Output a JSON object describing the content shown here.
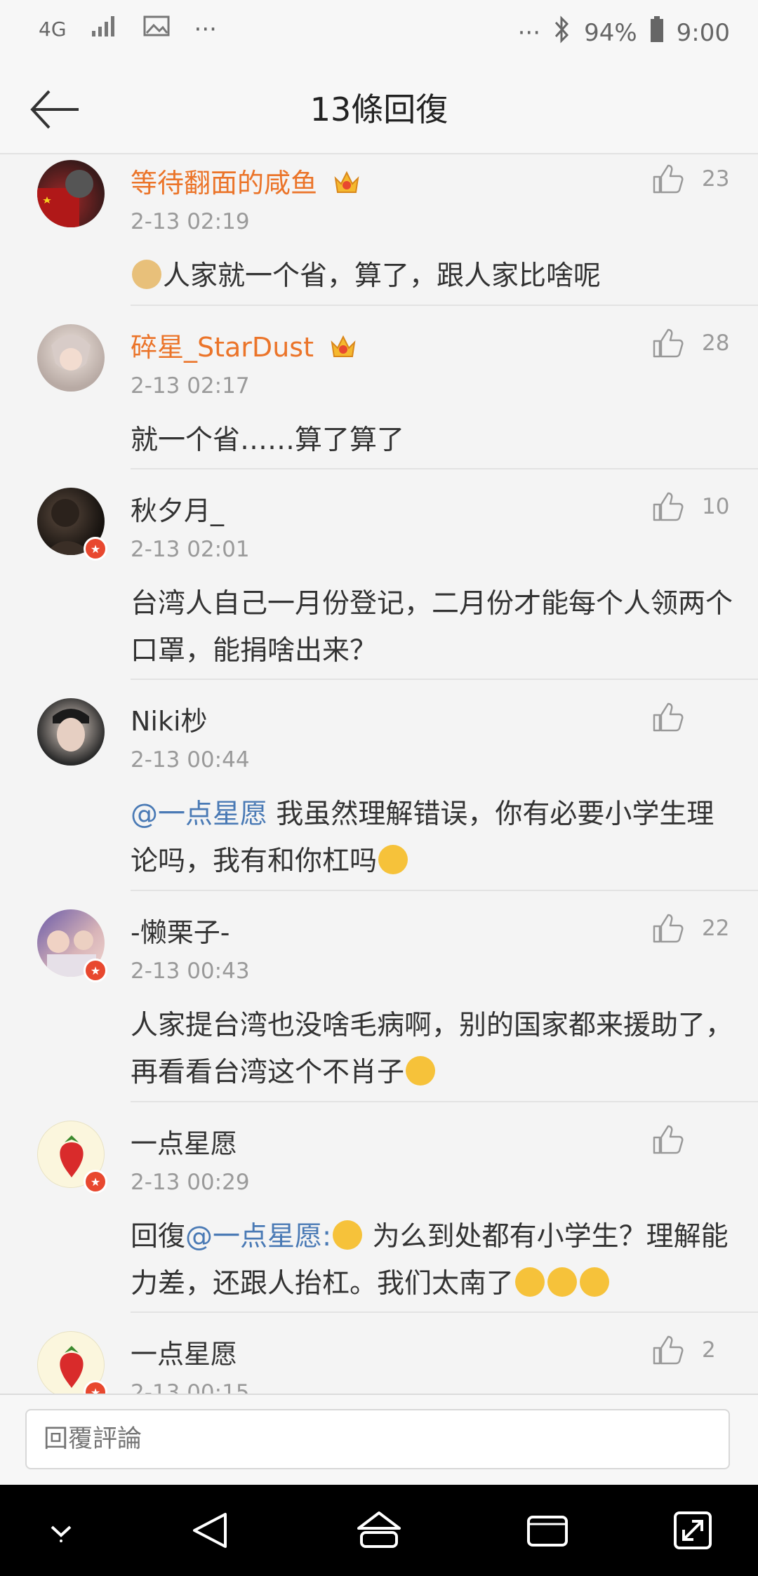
{
  "status_bar": {
    "network": "4G",
    "more_left": "···",
    "more_right": "···",
    "battery": "94%",
    "time": "9:00"
  },
  "header": {
    "title": "13條回復"
  },
  "comments": [
    {
      "name": "等待翻面的咸鱼",
      "time": "2-13 02:19",
      "text": "人家就一个省，算了，跟人家比啥呢",
      "likes": "23"
    },
    {
      "name": "碎星_StarDust",
      "time": "2-13 02:17",
      "text": "就一个省……算了算了",
      "likes": "28"
    },
    {
      "name": "秋夕月_",
      "time": "2-13 02:01",
      "text": "台湾人自己一月份登记，二月份才能每个人领两个口罩，能捐啥出来？",
      "likes": "10"
    },
    {
      "name": "Niki杪",
      "time": "2-13 00:44",
      "mention": "@一点星愿",
      "text": " 我虽然理解错误，你有必要小学生理论吗，我有和你杠吗",
      "likes": ""
    },
    {
      "name": "-懒栗子-",
      "time": "2-13 00:43",
      "text": "人家提台湾也没啥毛病啊，别的国家都来援助了，再看看台湾这个不肖子",
      "likes": "22"
    },
    {
      "name": "一点星愿",
      "time": "2-13 00:29",
      "prefix": "回復",
      "mention": "@一点星愿",
      "colon": ":",
      "text": " 为么到处都有小学生？理解能力差，还跟人抬杠。我们太南了",
      "likes": ""
    },
    {
      "name": "一点星愿",
      "time": "2-13 00:15",
      "likes": "2"
    }
  ],
  "reply_input": {
    "placeholder": "回覆評論"
  },
  "colors": {
    "accent_orange": "#eb7429",
    "mention_blue": "#4a7ab5",
    "verified_red": "#e8482f"
  }
}
